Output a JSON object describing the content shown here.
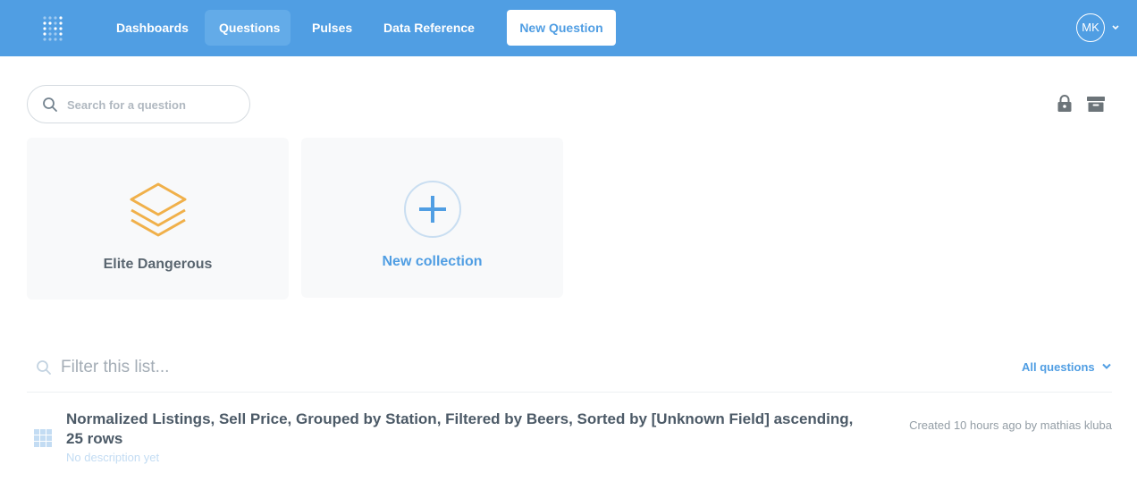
{
  "nav": {
    "items": [
      {
        "label": "Dashboards",
        "active": false
      },
      {
        "label": "Questions",
        "active": true
      },
      {
        "label": "Pulses",
        "active": false
      },
      {
        "label": "Data Reference",
        "active": false
      }
    ],
    "new_question_label": "New Question",
    "user_initials": "MK"
  },
  "search": {
    "placeholder": "Search for a question"
  },
  "collections": [
    {
      "label": "Elite Dangerous",
      "icon": "layers-icon",
      "color": "#f0b04a"
    },
    {
      "label": "New collection",
      "icon": "plus-circle-icon",
      "color": "#509ee3"
    }
  ],
  "filter": {
    "placeholder": "Filter this list...",
    "dropdown_label": "All questions"
  },
  "questions": [
    {
      "title": "Normalized Listings, Sell Price, Grouped by Station, Filtered by Beers, Sorted by [Unknown Field] ascending, 25 rows",
      "description": "No description yet",
      "meta": "Created 10 hours ago by mathias kluba",
      "icon": "table-icon"
    }
  ],
  "colors": {
    "brand": "#509ee3",
    "accent_yellow": "#f0b04a",
    "card_bg": "#f8f9fa"
  }
}
